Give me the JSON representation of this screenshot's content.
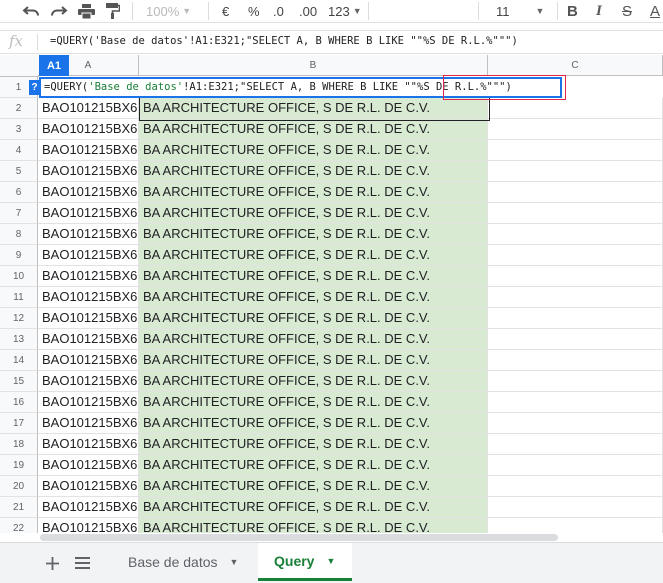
{
  "toolbar": {
    "zoom": "100%",
    "currency": "€",
    "percent": "%",
    "decimal_decrease": ".0",
    "decimal_increase": ".00",
    "more_formats": "123",
    "font_size": "11",
    "bold": "B",
    "italic": "I",
    "strike": "S",
    "text_color": "A"
  },
  "formula_bar": {
    "fx": "fx",
    "formula": "=QUERY('Base de datos'!A1:E321;\"SELECT A, B WHERE B LIKE \"\"%S DE R.L.%\"\"\")"
  },
  "grid": {
    "name_box": "A1",
    "columns": [
      "A",
      "B",
      "C"
    ],
    "editor": {
      "prefix": "=QUERY(",
      "sheet_ref": "'Base de datos'",
      "rest_plain": "!A1:E321;",
      "rest_string": "\"SELECT A, B WHERE B LIKE \"\"%S DE R.L.%\"\"\"",
      "close": ")"
    },
    "row_numbers": [
      "1",
      "2",
      "3",
      "4",
      "5",
      "6",
      "7",
      "8",
      "9",
      "10",
      "11",
      "12",
      "13",
      "14",
      "15",
      "16",
      "17",
      "18",
      "19",
      "20",
      "21",
      "22"
    ],
    "rows": [
      {
        "a": "BAO101215BX6",
        "b": "BA ARCHITECTURE OFFICE, S DE R.L. DE C.V."
      },
      {
        "a": "BAO101215BX6",
        "b": "BA ARCHITECTURE OFFICE, S DE R.L. DE C.V."
      },
      {
        "a": "BAO101215BX6",
        "b": "BA ARCHITECTURE OFFICE, S DE R.L. DE C.V."
      },
      {
        "a": "BAO101215BX6",
        "b": "BA ARCHITECTURE OFFICE, S DE R.L. DE C.V."
      },
      {
        "a": "BAO101215BX6",
        "b": "BA ARCHITECTURE OFFICE, S DE R.L. DE C.V."
      },
      {
        "a": "BAO101215BX6",
        "b": "BA ARCHITECTURE OFFICE, S DE R.L. DE C.V."
      },
      {
        "a": "BAO101215BX6",
        "b": "BA ARCHITECTURE OFFICE, S DE R.L. DE C.V."
      },
      {
        "a": "BAO101215BX6",
        "b": "BA ARCHITECTURE OFFICE, S DE R.L. DE C.V."
      },
      {
        "a": "BAO101215BX6",
        "b": "BA ARCHITECTURE OFFICE, S DE R.L. DE C.V."
      },
      {
        "a": "BAO101215BX6",
        "b": "BA ARCHITECTURE OFFICE, S DE R.L. DE C.V."
      },
      {
        "a": "BAO101215BX6",
        "b": "BA ARCHITECTURE OFFICE, S DE R.L. DE C.V."
      },
      {
        "a": "BAO101215BX6",
        "b": "BA ARCHITECTURE OFFICE, S DE R.L. DE C.V."
      },
      {
        "a": "BAO101215BX6",
        "b": "BA ARCHITECTURE OFFICE, S DE R.L. DE C.V."
      },
      {
        "a": "BAO101215BX6",
        "b": "BA ARCHITECTURE OFFICE, S DE R.L. DE C.V."
      },
      {
        "a": "BAO101215BX6",
        "b": "BA ARCHITECTURE OFFICE, S DE R.L. DE C.V."
      },
      {
        "a": "BAO101215BX6",
        "b": "BA ARCHITECTURE OFFICE, S DE R.L. DE C.V."
      },
      {
        "a": "BAO101215BX6",
        "b": "BA ARCHITECTURE OFFICE, S DE R.L. DE C.V."
      },
      {
        "a": "BAO101215BX6",
        "b": "BA ARCHITECTURE OFFICE, S DE R.L. DE C.V."
      },
      {
        "a": "BAO101215BX6",
        "b": "BA ARCHITECTURE OFFICE, S DE R.L. DE C.V."
      },
      {
        "a": "BAO101215BX6",
        "b": "BA ARCHITECTURE OFFICE, S DE R.L. DE C.V."
      },
      {
        "a": "BAO101215BX6",
        "b": "BA ARCHITECTURE OFFICE, S DE R.L. DE C.V."
      }
    ]
  },
  "sheet_tabs": {
    "tabs": [
      {
        "label": "Base de datos",
        "active": false
      },
      {
        "label": "Query",
        "active": true
      }
    ]
  },
  "colors": {
    "accent": "#1a73e8",
    "result_fill": "#d9ead3",
    "active_tab": "#188038",
    "highlight_box": "#e0264a"
  }
}
